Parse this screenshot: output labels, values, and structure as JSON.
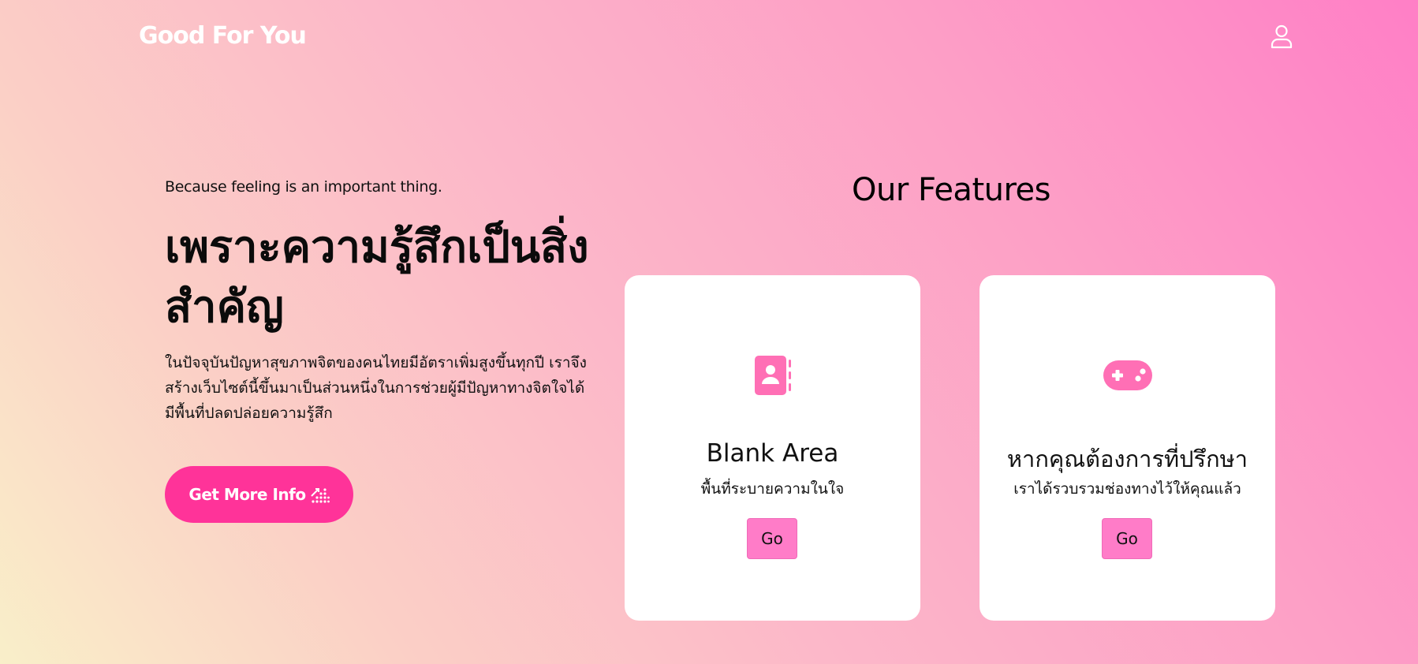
{
  "navbar": {
    "brand": "Good For You",
    "user_icon": "user-icon"
  },
  "hero": {
    "tagline": "Because feeling is an important thing.",
    "title": "เพราะความรู้สึกเป็นสิ่งสำคัญ",
    "description": "ในปัจจุบันปัญหาสุขภาพจิตของคนไทยมีอัตราเพิ่มสูงขึ้นทุกปี เราจึงสร้างเว็บไซต์นี้ขึ้นมาเป็นส่วนหนึ่งในการช่วยผู้มีปัญหาทางจิตใจได้มีพื้นที่ปลดปล่อยความรู้สึก",
    "cta_label": "Get More Info",
    "cta_icon": "chart-dots-icon"
  },
  "features": {
    "heading": "Our Features",
    "cards": [
      {
        "icon": "contact-book-icon",
        "title": "Blank Area",
        "subtitle": "พื้นที่ระบายความในใจ",
        "button": "Go"
      },
      {
        "icon": "gamepad-icon",
        "title": "หากคุณต้องการที่ปรึกษา",
        "subtitle": "เราได้รวบรวมช่องทางไว้ให้คุณแล้ว",
        "button": "Go"
      }
    ]
  },
  "colors": {
    "accent": "#ff3399",
    "button_pink": "#ff7cc8",
    "icon_pink": "#ff6fb5",
    "card_bg": "#ffffff"
  }
}
